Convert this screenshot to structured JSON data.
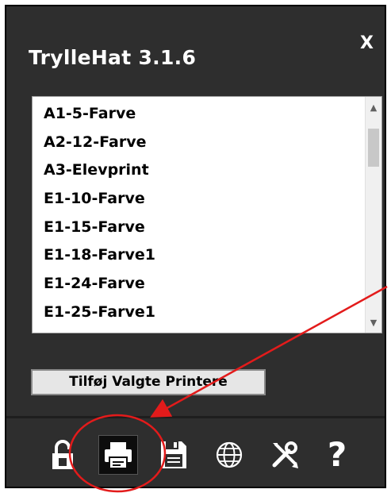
{
  "window": {
    "title": "TrylleHat 3.1.6",
    "close_label": "X"
  },
  "printer_list": {
    "items": [
      "A1-5-Farve",
      "A2-12-Farve",
      "A3-Elevprint",
      "E1-10-Farve",
      "E1-15-Farve",
      "E1-18-Farve1",
      "E1-24-Farve",
      "E1-25-Farve1"
    ]
  },
  "add_button": {
    "label": "Tilføj Valgte Printere"
  },
  "toolbar": {
    "icons": [
      "lock-icon",
      "printer-icon",
      "save-icon",
      "globe-icon",
      "tools-icon",
      "help-icon"
    ],
    "active": "printer-icon",
    "help_label": "?"
  },
  "annotation": {
    "color": "#e31b1b"
  },
  "colors": {
    "background": "#2e2e2e",
    "text": "#ffffff"
  }
}
